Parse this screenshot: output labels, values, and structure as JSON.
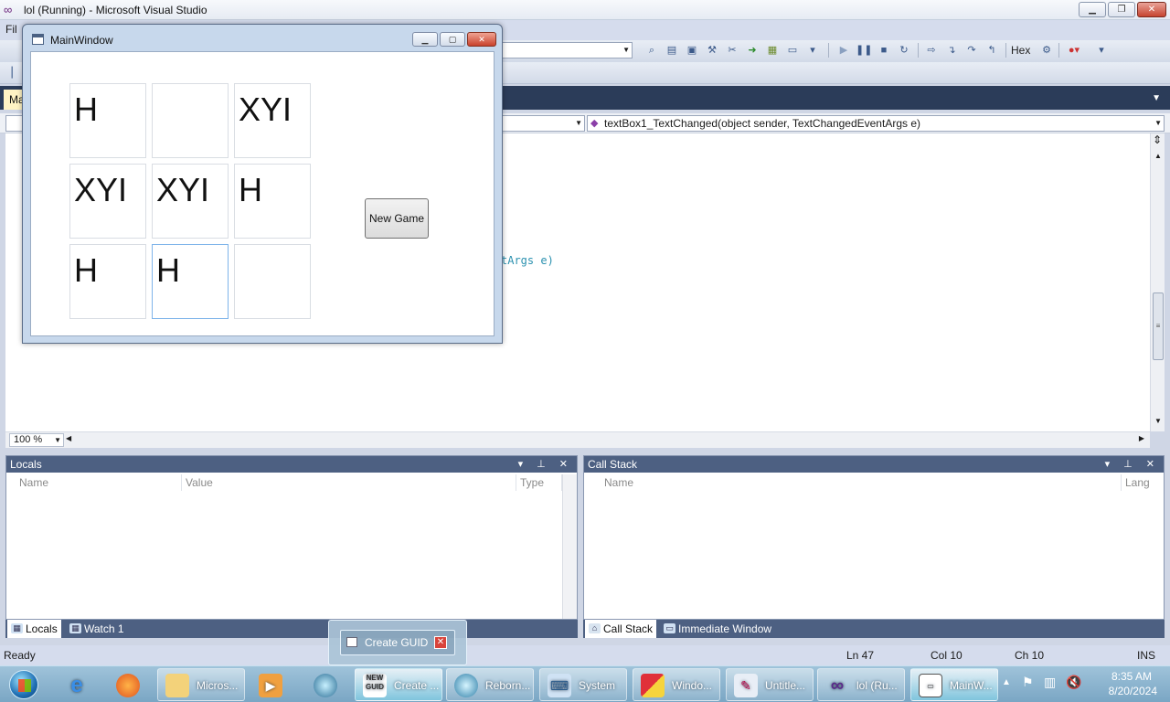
{
  "vs": {
    "title": "lol (Running) - Microsoft Visual Studio",
    "menu_file": "Fil",
    "toolbar_hex": "Hex",
    "doc_tab": "Ma",
    "nav_member": "textBox1_TextChanged(object sender, TextChangedEventArgs e)",
    "code_fragment": "tArgs e)",
    "zoom": "100 %"
  },
  "main_window": {
    "title": "MainWindow",
    "cells": [
      "H",
      "",
      "XYI",
      "XYI",
      "XYI",
      "H",
      "H",
      "H",
      ""
    ],
    "new_game_label": "New Game"
  },
  "locals": {
    "title": "Locals",
    "columns": [
      "Name",
      "Value",
      "Type"
    ]
  },
  "call_stack": {
    "title": "Call Stack",
    "columns": [
      "Name",
      "Lang"
    ]
  },
  "bottom_tabs_left": [
    "Locals",
    "Watch 1"
  ],
  "bottom_tabs_right": [
    "Call Stack",
    "Immediate Window"
  ],
  "status": {
    "ready": "Ready",
    "ln": "Ln 47",
    "col": "Col 10",
    "ch": "Ch 10",
    "ins": "INS"
  },
  "thumbnail": {
    "label": "Create GUID"
  },
  "taskbar": {
    "items": [
      "Micros...",
      "Create ...",
      "Reborn...",
      "System",
      "Windo...",
      "Untitle...",
      "lol (Ru...",
      "MainW..."
    ],
    "time": "8:35 AM",
    "date": "8/20/2024"
  },
  "icons": {
    "ie": "internet-explorer-icon",
    "firefox": "firefox-icon",
    "folder": "folder-icon",
    "media": "media-player-icon",
    "globe": "globe-icon"
  },
  "colors": {
    "vs_tab_accent": "#2b3c59",
    "toolwin_header": "#4d6082",
    "editor_identifier": "#2b91af"
  }
}
